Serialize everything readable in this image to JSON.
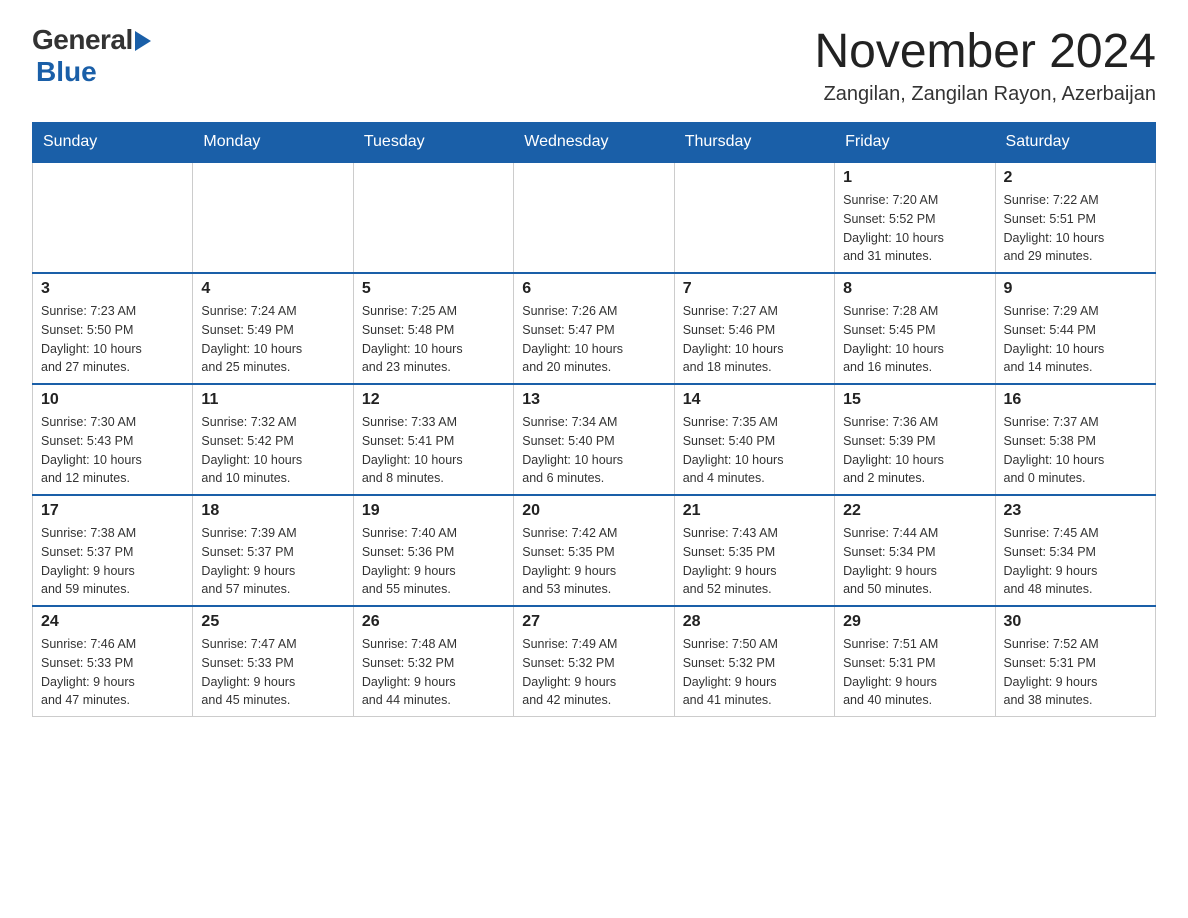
{
  "header": {
    "logo_general": "General",
    "logo_blue": "Blue",
    "month_title": "November 2024",
    "location": "Zangilan, Zangilan Rayon, Azerbaijan"
  },
  "calendar": {
    "days_of_week": [
      "Sunday",
      "Monday",
      "Tuesday",
      "Wednesday",
      "Thursday",
      "Friday",
      "Saturday"
    ],
    "weeks": [
      [
        {
          "day": "",
          "info": ""
        },
        {
          "day": "",
          "info": ""
        },
        {
          "day": "",
          "info": ""
        },
        {
          "day": "",
          "info": ""
        },
        {
          "day": "",
          "info": ""
        },
        {
          "day": "1",
          "info": "Sunrise: 7:20 AM\nSunset: 5:52 PM\nDaylight: 10 hours\nand 31 minutes."
        },
        {
          "day": "2",
          "info": "Sunrise: 7:22 AM\nSunset: 5:51 PM\nDaylight: 10 hours\nand 29 minutes."
        }
      ],
      [
        {
          "day": "3",
          "info": "Sunrise: 7:23 AM\nSunset: 5:50 PM\nDaylight: 10 hours\nand 27 minutes."
        },
        {
          "day": "4",
          "info": "Sunrise: 7:24 AM\nSunset: 5:49 PM\nDaylight: 10 hours\nand 25 minutes."
        },
        {
          "day": "5",
          "info": "Sunrise: 7:25 AM\nSunset: 5:48 PM\nDaylight: 10 hours\nand 23 minutes."
        },
        {
          "day": "6",
          "info": "Sunrise: 7:26 AM\nSunset: 5:47 PM\nDaylight: 10 hours\nand 20 minutes."
        },
        {
          "day": "7",
          "info": "Sunrise: 7:27 AM\nSunset: 5:46 PM\nDaylight: 10 hours\nand 18 minutes."
        },
        {
          "day": "8",
          "info": "Sunrise: 7:28 AM\nSunset: 5:45 PM\nDaylight: 10 hours\nand 16 minutes."
        },
        {
          "day": "9",
          "info": "Sunrise: 7:29 AM\nSunset: 5:44 PM\nDaylight: 10 hours\nand 14 minutes."
        }
      ],
      [
        {
          "day": "10",
          "info": "Sunrise: 7:30 AM\nSunset: 5:43 PM\nDaylight: 10 hours\nand 12 minutes."
        },
        {
          "day": "11",
          "info": "Sunrise: 7:32 AM\nSunset: 5:42 PM\nDaylight: 10 hours\nand 10 minutes."
        },
        {
          "day": "12",
          "info": "Sunrise: 7:33 AM\nSunset: 5:41 PM\nDaylight: 10 hours\nand 8 minutes."
        },
        {
          "day": "13",
          "info": "Sunrise: 7:34 AM\nSunset: 5:40 PM\nDaylight: 10 hours\nand 6 minutes."
        },
        {
          "day": "14",
          "info": "Sunrise: 7:35 AM\nSunset: 5:40 PM\nDaylight: 10 hours\nand 4 minutes."
        },
        {
          "day": "15",
          "info": "Sunrise: 7:36 AM\nSunset: 5:39 PM\nDaylight: 10 hours\nand 2 minutes."
        },
        {
          "day": "16",
          "info": "Sunrise: 7:37 AM\nSunset: 5:38 PM\nDaylight: 10 hours\nand 0 minutes."
        }
      ],
      [
        {
          "day": "17",
          "info": "Sunrise: 7:38 AM\nSunset: 5:37 PM\nDaylight: 9 hours\nand 59 minutes."
        },
        {
          "day": "18",
          "info": "Sunrise: 7:39 AM\nSunset: 5:37 PM\nDaylight: 9 hours\nand 57 minutes."
        },
        {
          "day": "19",
          "info": "Sunrise: 7:40 AM\nSunset: 5:36 PM\nDaylight: 9 hours\nand 55 minutes."
        },
        {
          "day": "20",
          "info": "Sunrise: 7:42 AM\nSunset: 5:35 PM\nDaylight: 9 hours\nand 53 minutes."
        },
        {
          "day": "21",
          "info": "Sunrise: 7:43 AM\nSunset: 5:35 PM\nDaylight: 9 hours\nand 52 minutes."
        },
        {
          "day": "22",
          "info": "Sunrise: 7:44 AM\nSunset: 5:34 PM\nDaylight: 9 hours\nand 50 minutes."
        },
        {
          "day": "23",
          "info": "Sunrise: 7:45 AM\nSunset: 5:34 PM\nDaylight: 9 hours\nand 48 minutes."
        }
      ],
      [
        {
          "day": "24",
          "info": "Sunrise: 7:46 AM\nSunset: 5:33 PM\nDaylight: 9 hours\nand 47 minutes."
        },
        {
          "day": "25",
          "info": "Sunrise: 7:47 AM\nSunset: 5:33 PM\nDaylight: 9 hours\nand 45 minutes."
        },
        {
          "day": "26",
          "info": "Sunrise: 7:48 AM\nSunset: 5:32 PM\nDaylight: 9 hours\nand 44 minutes."
        },
        {
          "day": "27",
          "info": "Sunrise: 7:49 AM\nSunset: 5:32 PM\nDaylight: 9 hours\nand 42 minutes."
        },
        {
          "day": "28",
          "info": "Sunrise: 7:50 AM\nSunset: 5:32 PM\nDaylight: 9 hours\nand 41 minutes."
        },
        {
          "day": "29",
          "info": "Sunrise: 7:51 AM\nSunset: 5:31 PM\nDaylight: 9 hours\nand 40 minutes."
        },
        {
          "day": "30",
          "info": "Sunrise: 7:52 AM\nSunset: 5:31 PM\nDaylight: 9 hours\nand 38 minutes."
        }
      ]
    ]
  }
}
